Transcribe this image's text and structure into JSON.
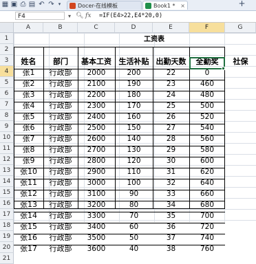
{
  "window": {
    "tabs": [
      {
        "label": "Docer-在线模板"
      },
      {
        "label": "Book1 *"
      }
    ],
    "tab_close": "×",
    "new_tab": "+"
  },
  "formula_bar": {
    "name_box": "F4",
    "fx_label": "fx",
    "formula": "=IF(E4>22,E4*20,0)"
  },
  "columns": [
    "A",
    "B",
    "C",
    "D",
    "E",
    "F",
    "G"
  ],
  "selected_column": "F",
  "rows": [
    "1",
    "2",
    "3",
    "4",
    "5",
    "6",
    "7",
    "8",
    "9",
    "10",
    "11",
    "12",
    "13",
    "14",
    "15",
    "16",
    "17",
    "18",
    "19",
    "20",
    "21"
  ],
  "selected_row": "4",
  "sheet": {
    "title": "工资表",
    "headers": [
      "姓名",
      "部门",
      "基本工资",
      "生活补贴",
      "出勤天数",
      "全勤奖",
      "社保"
    ],
    "data_rows": [
      [
        "张1",
        "行政部",
        "2000",
        "200",
        "22",
        "0",
        ""
      ],
      [
        "张2",
        "行政部",
        "2100",
        "190",
        "23",
        "460",
        ""
      ],
      [
        "张3",
        "行政部",
        "2200",
        "180",
        "24",
        "480",
        ""
      ],
      [
        "张4",
        "行政部",
        "2300",
        "170",
        "25",
        "500",
        ""
      ],
      [
        "张5",
        "行政部",
        "2400",
        "160",
        "26",
        "520",
        ""
      ],
      [
        "张6",
        "行政部",
        "2500",
        "150",
        "27",
        "540",
        ""
      ],
      [
        "张7",
        "行政部",
        "2600",
        "140",
        "28",
        "560",
        ""
      ],
      [
        "张8",
        "行政部",
        "2700",
        "130",
        "29",
        "580",
        ""
      ],
      [
        "张9",
        "行政部",
        "2800",
        "120",
        "30",
        "600",
        ""
      ],
      [
        "张10",
        "行政部",
        "2900",
        "110",
        "31",
        "620",
        ""
      ],
      [
        "张11",
        "行政部",
        "3000",
        "100",
        "32",
        "640",
        ""
      ],
      [
        "张12",
        "行政部",
        "3100",
        "90",
        "33",
        "660",
        ""
      ],
      [
        "张13",
        "行政部",
        "3200",
        "80",
        "34",
        "680",
        ""
      ],
      [
        "张14",
        "行政部",
        "3300",
        "70",
        "35",
        "700",
        ""
      ],
      [
        "张15",
        "行政部",
        "3400",
        "60",
        "36",
        "720",
        ""
      ],
      [
        "张16",
        "行政部",
        "3500",
        "50",
        "37",
        "740",
        ""
      ],
      [
        "张17",
        "行政部",
        "3600",
        "40",
        "38",
        "760",
        ""
      ]
    ]
  },
  "colors": {
    "selection_border": "#1f6f3f",
    "header_highlight": "#f7df9c",
    "grid_line": "#dadfe6"
  }
}
